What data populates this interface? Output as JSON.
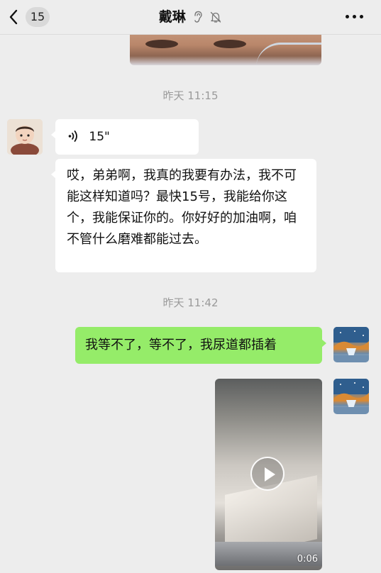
{
  "header": {
    "unread_count": "15",
    "title": "戴琳"
  },
  "colors": {
    "background": "#ededed",
    "sent_bubble": "#95ec69",
    "received_bubble": "#ffffff",
    "timestamp_text": "#9a9a9a"
  },
  "messages": {
    "timestamp_1": "昨天 11:15",
    "voice_duration": "15\"",
    "text_received": "哎，弟弟啊，我真的我要有办法，我不可能这样知道吗？最快15号，我能给你这个，我能保证你的。你好好的加油啊，咱不管什么磨难都能过去。",
    "timestamp_2": "昨天 11:42",
    "text_sent": "我等不了，等不了，我尿道都插着",
    "video_duration": "0:06"
  },
  "icons": {
    "back": "chevron-left-icon",
    "ear": "ear-icon",
    "mute": "bell-off-icon",
    "more": "more-dots-icon",
    "voice": "voice-wave-icon",
    "play": "play-icon"
  }
}
